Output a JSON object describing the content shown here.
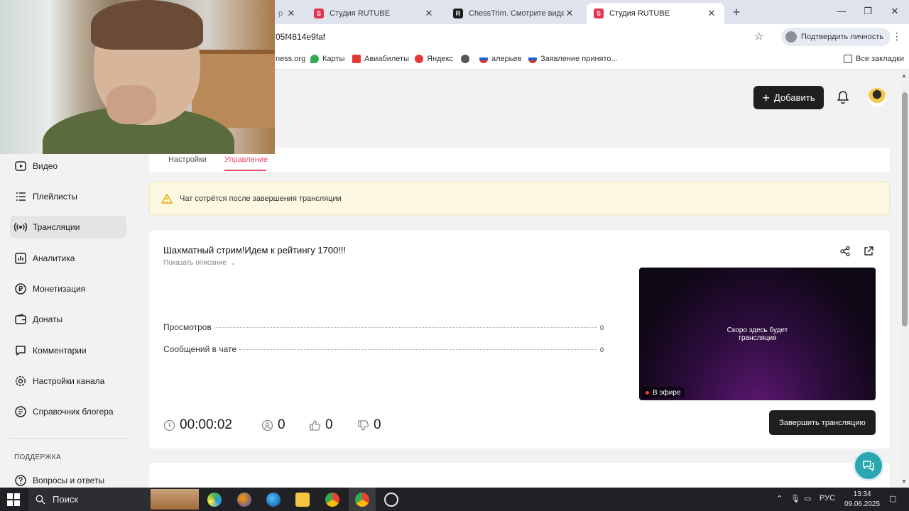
{
  "browser": {
    "tabs": [
      {
        "label": "Студия RUTUBE",
        "active": false
      },
      {
        "label": "ChessTrim. Смотрите видео он",
        "active": false
      },
      {
        "label": "Студия RUTUBE",
        "active": true
      }
    ],
    "partial_tab_text": "р",
    "url_fragment": "05f4814e9faf",
    "verify_label": "Подтвердить личность",
    "bookmarks": [
      "ness.org",
      "Карты",
      "Авиабилеты",
      "Яндекс",
      "алерьев",
      "Заявление принято..."
    ],
    "all_bookmarks_label": "Все закладки"
  },
  "header": {
    "add_label": "Добавить"
  },
  "sidebar": {
    "items": [
      {
        "label": "Видео",
        "icon": "video-icon"
      },
      {
        "label": "Плейлисты",
        "icon": "list-icon"
      },
      {
        "label": "Трансляции",
        "icon": "broadcast-icon",
        "active": true
      },
      {
        "label": "Аналитика",
        "icon": "analytics-icon"
      },
      {
        "label": "Монетизация",
        "icon": "money-icon"
      },
      {
        "label": "Донаты",
        "icon": "wallet-icon"
      },
      {
        "label": "Комментарии",
        "icon": "comment-icon"
      },
      {
        "label": "Настройки канала",
        "icon": "gear-icon"
      },
      {
        "label": "Справочник блогера",
        "icon": "book-icon"
      }
    ],
    "support_heading": "ПОДДЕРЖКА",
    "support_items": [
      {
        "label": "Вопросы и ответы",
        "icon": "help-icon"
      }
    ]
  },
  "main": {
    "subtabs": [
      "Настройки",
      "Управление"
    ],
    "warning": "Чат сотрётся после завершения трансляции",
    "stream_title": "Шахматный стрим!Идем к рейтингу 1700!!!",
    "show_description": "Показать описание",
    "stats": [
      {
        "label": "Просмотров",
        "value": "0"
      },
      {
        "label": "Сообщений в чате",
        "value": "0"
      }
    ],
    "player_text_line1": "Скоро здесь будет",
    "player_text_line2": "трансляция",
    "live_badge": "В эфире",
    "duration": "00:00:02",
    "viewers": "0",
    "likes": "0",
    "dislikes": "0",
    "end_button": "Завершить трансляцию"
  },
  "taskbar": {
    "search_label": "Поиск",
    "language": "РУС",
    "time": "13:34",
    "date": "09.06.2025"
  },
  "colors": {
    "accent": "#e94e6a",
    "dark_button": "#1f1f1f",
    "warning_bg": "#fdf8e1",
    "support_fab": "#2aa7b0"
  }
}
